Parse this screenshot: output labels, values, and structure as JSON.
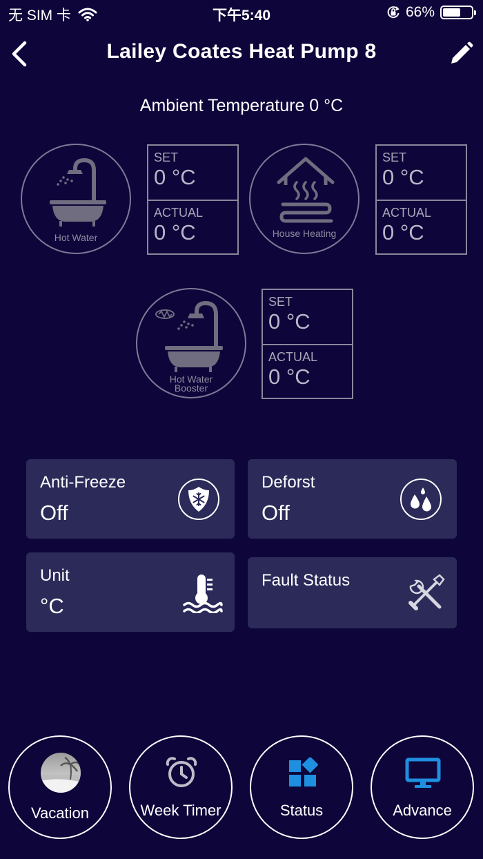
{
  "status_bar": {
    "carrier": "无 SIM 卡",
    "time": "下午5:40",
    "battery_percent": "66%",
    "battery_level": 0.66
  },
  "header": {
    "title": "Lailey Coates Heat Pump 8"
  },
  "ambient": "Ambient Temperature 0 °C",
  "devices": [
    {
      "name": "Hot Water",
      "set_label": "SET",
      "set_value": "0 °C",
      "actual_label": "ACTUAL",
      "actual_value": "0 °C"
    },
    {
      "name": "House Heating",
      "set_label": "SET",
      "set_value": "0 °C",
      "actual_label": "ACTUAL",
      "actual_value": "0 °C"
    },
    {
      "name_line1": "Hot Water",
      "name_line2": "Booster",
      "set_label": "SET",
      "set_value": "0 °C",
      "actual_label": "ACTUAL",
      "actual_value": "0 °C"
    }
  ],
  "cards": {
    "anti_freeze": {
      "title": "Anti-Freeze",
      "value": "Off",
      "icon": "snowflake-shield-icon"
    },
    "defrost": {
      "title": "Deforst",
      "value": "Off",
      "icon": "droplets-icon"
    },
    "unit": {
      "title": "Unit",
      "value": "°C",
      "icon": "thermometer-water-icon"
    },
    "fault": {
      "title": "Fault Status",
      "icon": "tools-icon"
    }
  },
  "bottom_nav": {
    "vacation": "Vacation",
    "week_timer": "Week Timer",
    "status": "Status",
    "advance": "Advance"
  },
  "colors": {
    "background": "#0e063a",
    "card": "#2b2a59",
    "accent_blue": "#1f8fe0",
    "muted_gray": "#8d8a9e"
  }
}
